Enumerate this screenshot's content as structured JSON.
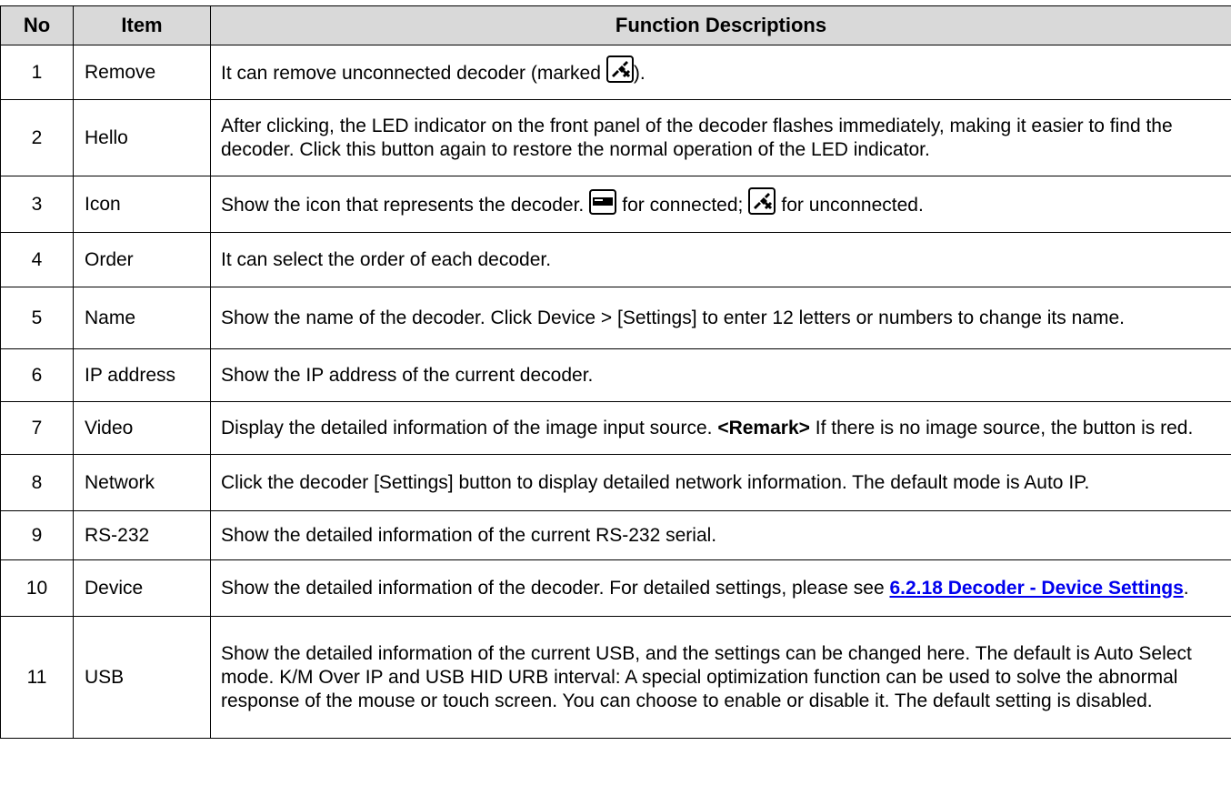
{
  "table": {
    "headers": {
      "no": "No",
      "item": "Item",
      "desc": "Function Descriptions"
    },
    "rows": [
      {
        "no": "1",
        "item": "Remove",
        "desc_pre": "It can remove unconnected decoder (marked",
        "desc_post": ")."
      },
      {
        "no": "2",
        "item": "Hello",
        "desc": "After clicking, the LED indicator on the front panel of the decoder flashes immediately, making it easier to find the decoder. Click this button again to restore the normal operation of the LED indicator."
      },
      {
        "no": "3",
        "item": "Icon",
        "desc_pre": "Show the icon that represents the decoder.",
        "desc_mid": "for connected;",
        "desc_post": "for unconnected."
      },
      {
        "no": "4",
        "item": "Order",
        "desc": "It can select the order of each decoder."
      },
      {
        "no": "5",
        "item": "Name",
        "desc": "Show the name of the decoder. Click Device > [Settings] to enter 12 letters or numbers to change its name."
      },
      {
        "no": "6",
        "item": "IP address",
        "desc": "Show the IP address of the current decoder."
      },
      {
        "no": "7",
        "item": "Video",
        "desc_pre": "Display the detailed information of the image input source.",
        "desc_bold": "<Remark>",
        "desc_post": "If there is no image source, the button is red."
      },
      {
        "no": "8",
        "item": "Network",
        "desc": "Click the decoder [Settings] button to display detailed network information. The default mode is Auto IP."
      },
      {
        "no": "9",
        "item": "RS-232",
        "desc": "Show the detailed information of the current RS-232 serial."
      },
      {
        "no": "10",
        "item": "Device",
        "desc_pre": "Show the detailed information of the decoder. For detailed settings, please see",
        "desc_link": "6.2.18 Decoder - Device Settings",
        "desc_post": "."
      },
      {
        "no": "11",
        "item": "USB",
        "desc": "Show the detailed information of the current USB, and the settings can be changed here. The default is Auto Select mode. K/M Over IP and USB HID URB interval: A special optimization function can be used to solve the abnormal response of the mouse or touch screen. You can choose to enable or disable it. The default setting is disabled."
      }
    ]
  },
  "icons": {
    "unconnected": "unconnected-decoder-icon",
    "connected": "connected-decoder-icon"
  }
}
